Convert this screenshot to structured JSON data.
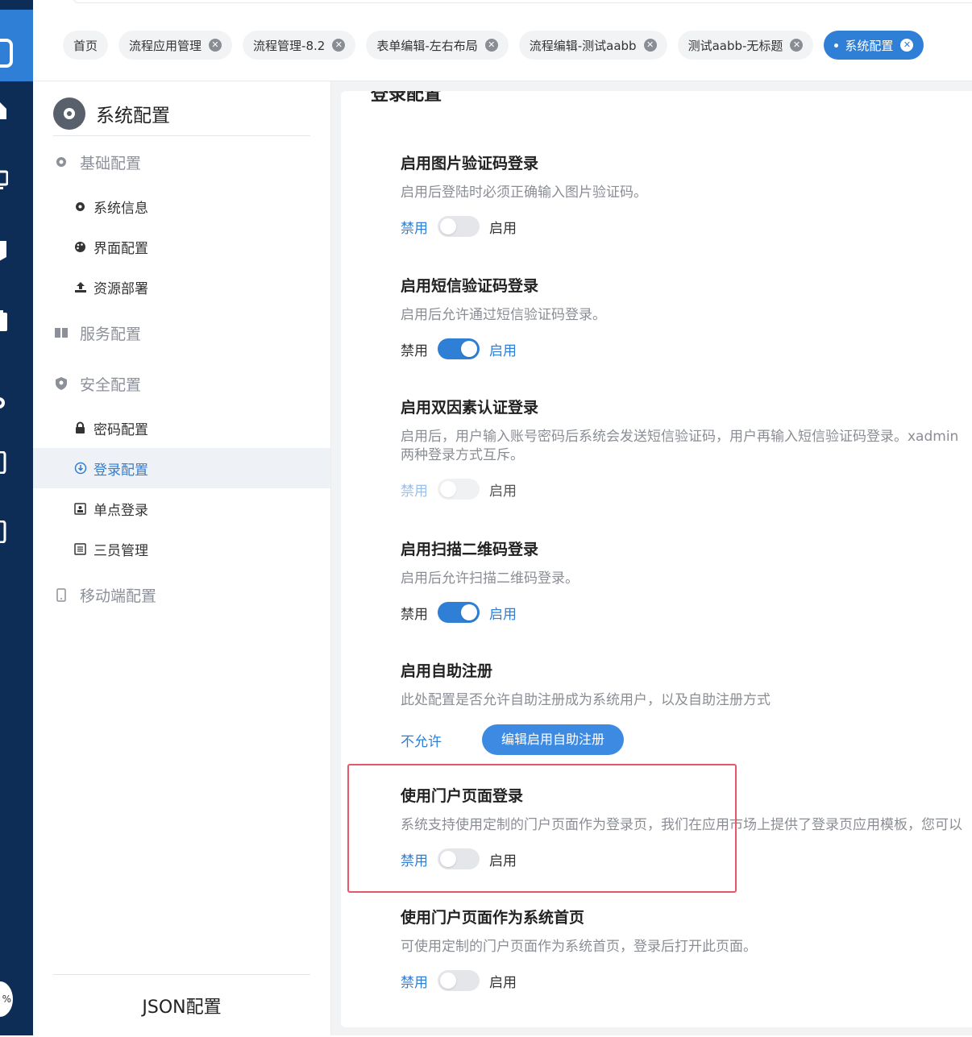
{
  "header": {
    "tabs": [
      {
        "label": "首页",
        "closable": false,
        "active": false
      },
      {
        "label": "流程应用管理",
        "closable": true,
        "active": false
      },
      {
        "label": "流程管理-8.2",
        "closable": true,
        "active": false
      },
      {
        "label": "表单编辑-左右布局",
        "closable": true,
        "active": false
      },
      {
        "label": "流程编辑-测试aabb",
        "closable": true,
        "active": false
      },
      {
        "label": "测试aabb-无标题",
        "closable": true,
        "active": false
      },
      {
        "label": "系统配置",
        "closable": true,
        "active": true
      }
    ],
    "close_glyph": "✕"
  },
  "rail": {
    "percent_label": "%"
  },
  "sidebar": {
    "title": "系统配置",
    "groups": {
      "basic": "基础配置",
      "service": "服务配置",
      "security": "安全配置",
      "mobile": "移动端配置"
    },
    "items": {
      "system_info": "系统信息",
      "ui_config": "界面配置",
      "resource_deploy": "资源部署",
      "password": "密码配置",
      "login": "登录配置",
      "sso": "单点登录",
      "three_admins": "三员管理"
    },
    "footer": "JSON配置"
  },
  "main": {
    "title": "登录配置",
    "sections": {
      "captcha": {
        "title": "启用图片验证码登录",
        "desc": "启用后登陆时必须正确输入图片验证码。",
        "off": "禁用",
        "on": "启用",
        "enabled": false
      },
      "sms": {
        "title": "启用短信验证码登录",
        "desc": "启用后允许通过短信验证码登录。",
        "off": "禁用",
        "on": "启用",
        "enabled": true
      },
      "twofa": {
        "title": "启用双因素认证登录",
        "desc": "启用后，用户输入账号密码后系统会发送短信验证码，用户再输入短信验证码登录。xadmin",
        "desc2": "两种登录方式互斥。",
        "off": "禁用",
        "on": "启用",
        "enabled": false,
        "disabled": true
      },
      "qrcode": {
        "title": "启用扫描二维码登录",
        "desc": "启用后允许扫描二维码登录。",
        "off": "禁用",
        "on": "启用",
        "enabled": true
      },
      "register": {
        "title": "启用自助注册",
        "desc": "此处配置是否允许自助注册成为系统用户，以及自助注册方式",
        "status": "不允许",
        "button": "编辑启用自助注册"
      },
      "portal_login": {
        "title": "使用门户页面登录",
        "desc": "系统支持使用定制的门户页面作为登录页，我们在应用市场上提供了登录页应用模板，您可以",
        "off": "禁用",
        "on": "启用",
        "enabled": false
      },
      "portal_home": {
        "title": "使用门户页面作为系统首页",
        "desc": "可使用定制的门户页面作为系统首页，登录后打开此页面。",
        "off": "禁用",
        "on": "启用",
        "enabled": false
      }
    }
  },
  "colors": {
    "rail": "#0d2d57",
    "accent": "#2f7fd6",
    "highlight_box": "#e8566a"
  }
}
